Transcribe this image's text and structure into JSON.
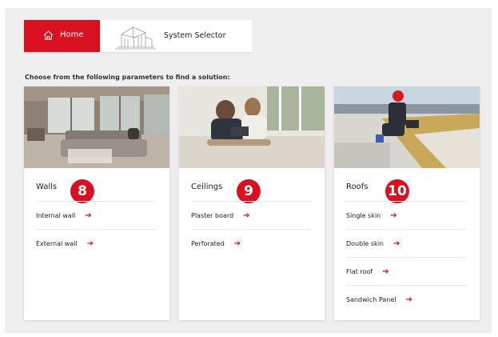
{
  "nav": {
    "home_label": "Home",
    "selector_label": "System Selector"
  },
  "intro_text": "Choose from the following parameters to find a solution:",
  "cards": [
    {
      "title": "Walls",
      "badge": "8",
      "options": [
        "Internal wall",
        "External wall"
      ]
    },
    {
      "title": "Ceilings",
      "badge": "9",
      "options": [
        "Plaster board",
        "Perforated"
      ]
    },
    {
      "title": "Roofs",
      "badge": "10",
      "options": [
        "Single skin",
        "Double skin",
        "Flat roof",
        "Sandwich Panel"
      ]
    }
  ],
  "arrow_glyph": "➔",
  "colors": {
    "accent": "#d9101f",
    "background": "#efefef"
  }
}
